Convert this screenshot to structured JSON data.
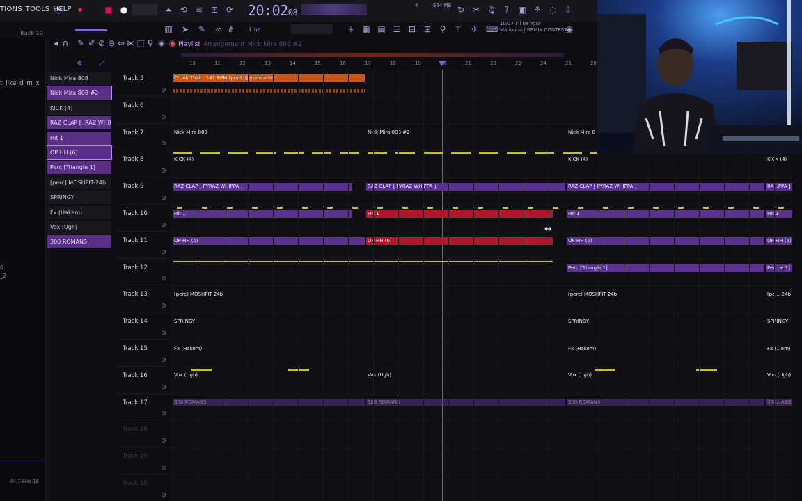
{
  "menu": {
    "items": [
      "TIONS",
      "TOOLS",
      "HELP"
    ]
  },
  "toolbar": {
    "clock": "20:02",
    "clock_frac": "08",
    "cpu_mem": "664 MB",
    "cpu_num": "4",
    "hint_line1": "10/27  I'll Be Your",
    "hint_line2": "Madonna | REMIX CONTEST",
    "pattern_mode": "Line",
    "left_track_label": "Track 10"
  },
  "playlist": {
    "title": "Playlist",
    "subtitle": "Arrangement",
    "crumb": "Nick Mira 808 #2",
    "ruler_marks": [
      "10",
      "11",
      "12",
      "13",
      "14",
      "15",
      "16",
      "17",
      "18",
      "19",
      "20",
      "21",
      "22",
      "23",
      "24",
      "25",
      "26"
    ]
  },
  "far_left": {
    "label": "t_like_d_m_x",
    "small1": "0",
    "small2": "_2",
    "status": "44.1 kHz  16"
  },
  "patterns": [
    {
      "label": "Nick Mira 808",
      "style": "dark"
    },
    {
      "label": "Nick Mira 808 #2",
      "style": "purple",
      "selected": true
    },
    {
      "label": "KICK (4)",
      "style": "dark"
    },
    {
      "label": "RAZ CLAP [..RAZ WHIPPA ]",
      "style": "purple"
    },
    {
      "label": "Hit 1",
      "style": "purple"
    },
    {
      "label": "OP HH (6)",
      "style": "purple",
      "selected": true
    },
    {
      "label": "Perc [Triangle 1]",
      "style": "purple"
    },
    {
      "label": "[perc] MOSHPIT-24b",
      "style": "dark"
    },
    {
      "label": "SPRINGY",
      "style": "dark"
    },
    {
      "label": "Fx (Hakem)",
      "style": "dark"
    },
    {
      "label": "Vox (Ugh)",
      "style": "dark"
    },
    {
      "label": "300 ROMANS",
      "style": "purple"
    }
  ],
  "tracks": [
    {
      "label": "Track 5",
      "dim": false
    },
    {
      "label": "Track 6",
      "dim": false
    },
    {
      "label": "Track 7",
      "dim": false
    },
    {
      "label": "Track 8",
      "dim": false
    },
    {
      "label": "Track 9",
      "dim": false
    },
    {
      "label": "Track 10",
      "dim": false
    },
    {
      "label": "Track 11",
      "dim": false
    },
    {
      "label": "Track 12",
      "dim": false
    },
    {
      "label": "Track 13",
      "dim": false
    },
    {
      "label": "Track 14",
      "dim": false
    },
    {
      "label": "Track 15",
      "dim": false
    },
    {
      "label": "Track 16",
      "dim": false
    },
    {
      "label": "Track 17",
      "dim": false
    },
    {
      "label": "Track 18",
      "dim": true
    },
    {
      "label": "Track 19",
      "dim": true
    },
    {
      "label": "Track 20",
      "dim": true
    }
  ],
  "clips": {
    "t5_a": "Crunk That - 147 BP..(prod. @ypmcarter)",
    "t5_b": "Crunk That - 147 BPM (prod. @ypmcarter)",
    "t7_a": "Nick Mira 808",
    "t7_b": "Nick Mira 808 #2",
    "t7_c": "Nick Mira 8",
    "t8_a": "KICK (4)",
    "t8_b": "KICK (4)",
    "t8_c": "KICK (4)",
    "t9_a": "RAZ CLAP [ PYRAZ WHIPPA ]",
    "t9_b": "RAZ CLAP [ PYRAZ WHIPPA ]",
    "t9_c": "RAZ CLAP [ PYRAZ WHIPPA ]",
    "t9_d": "RA...PPA ]",
    "t10_a": "Hit 1",
    "t10_b": "Hit 1",
    "t10_c": "Hit 1",
    "t10_d": "Hit 1",
    "t11_a": "OP HH (6)",
    "t11_b": "OP HH (6)",
    "t11_c": "OP HH (6)",
    "t11_d": "OP HH (6)",
    "t12_a": "Perc [Triangle 1]",
    "t12_b": "Per...le 1]",
    "t13_a": "[perc] MOSHPIT-24b",
    "t13_b": "[perc] MOSHPIT-24b",
    "t13_c": "[pe...-24b",
    "t14_a": "SPRINGY",
    "t14_b": "SPRINGY",
    "t14_c": "SPRINGY",
    "t15_a": "Fx (Hakem)",
    "t15_b": "Fx (Hakem)",
    "t15_c": "Fx (...em)",
    "t16_a": "Vox (Ugh)",
    "t16_b": "Vox (Ugh)",
    "t16_c": "Vox (Ugh)",
    "t16_d": "Vox (Ugh)",
    "t17_a": "300 ROMANS",
    "t17_b": "300 ROMANS",
    "t17_c": "300 ROMANS",
    "t17_d": "300...ANS"
  },
  "colors": {
    "accent": "#8c63d9",
    "clip_purple": "#5b3190",
    "clip_red": "#b3152a",
    "playhead": "#5e63d8",
    "notes": "#d8c85a"
  }
}
